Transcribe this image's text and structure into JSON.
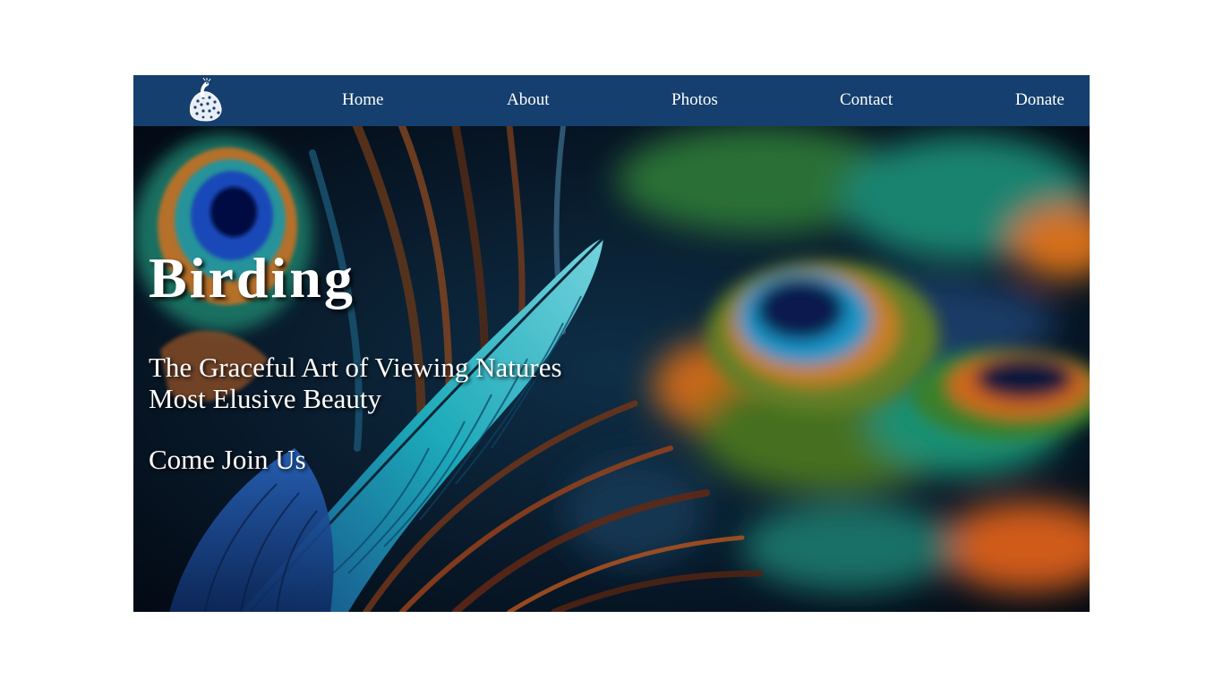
{
  "header": {
    "logo_icon": "peacock-icon",
    "nav": [
      {
        "label": "Home"
      },
      {
        "label": "About"
      },
      {
        "label": "Photos"
      },
      {
        "label": "Contact"
      },
      {
        "label": "Donate"
      }
    ]
  },
  "hero": {
    "title": "Birding",
    "subtitle": "The Graceful Art of Viewing Natures Most Elusive Beauty",
    "cta": "Come Join Us",
    "background_image": "peacock-feathers-image"
  },
  "colors": {
    "nav_background": "#153f6e",
    "text": "#ffffff",
    "page_background": "#ffffff"
  }
}
